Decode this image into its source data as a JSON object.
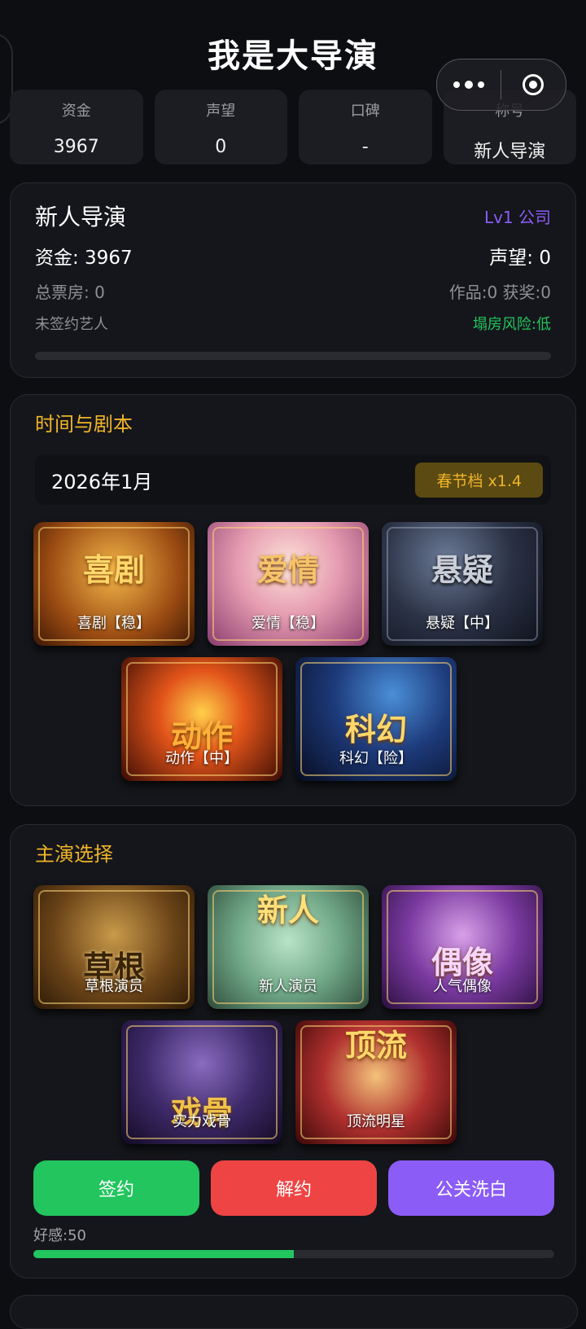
{
  "app": {
    "title": "我是大导演"
  },
  "stats": [
    {
      "label": "资金",
      "value": "3967"
    },
    {
      "label": "声望",
      "value": "0"
    },
    {
      "label": "口碑",
      "value": "-"
    },
    {
      "label": "称号",
      "value": "新人导演"
    }
  ],
  "profile": {
    "name": "新人导演",
    "level": "Lv1 公司",
    "funds": "资金: 3967",
    "reputation": "声望: 0",
    "box_office": "总票房: 0",
    "works": "作品:0 获奖:0",
    "artist": "未签约艺人",
    "risk": "塌房风险:低",
    "progress": 0
  },
  "time_script": {
    "title": "时间与剧本",
    "date": "2026年1月",
    "season_badge": "春节档 x1.4",
    "genres": [
      {
        "label": "喜剧【稳】",
        "art": "喜剧"
      },
      {
        "label": "爱情【稳】",
        "art": "爱情"
      },
      {
        "label": "悬疑【中】",
        "art": "悬疑"
      },
      {
        "label": "动作【中】",
        "art": "动作"
      },
      {
        "label": "科幻【险】",
        "art": "科幻"
      }
    ]
  },
  "lead": {
    "title": "主演选择",
    "actors": [
      {
        "label": "草根演员",
        "art": "草根"
      },
      {
        "label": "新人演员",
        "art": "新人"
      },
      {
        "label": "人气偶像",
        "art": "偶像"
      },
      {
        "label": "实力戏骨",
        "art": "戏骨"
      },
      {
        "label": "顶流明星",
        "art": "顶流"
      }
    ],
    "buttons": {
      "sign": "签约",
      "terminate": "解约",
      "pr": "公关洗白"
    },
    "favor": "好感:50",
    "favor_value": 0.5
  },
  "colors": {
    "accent_gold": "#f0b429",
    "purple": "#8b5cf6",
    "green": "#22c55e",
    "red": "#ef4444"
  }
}
